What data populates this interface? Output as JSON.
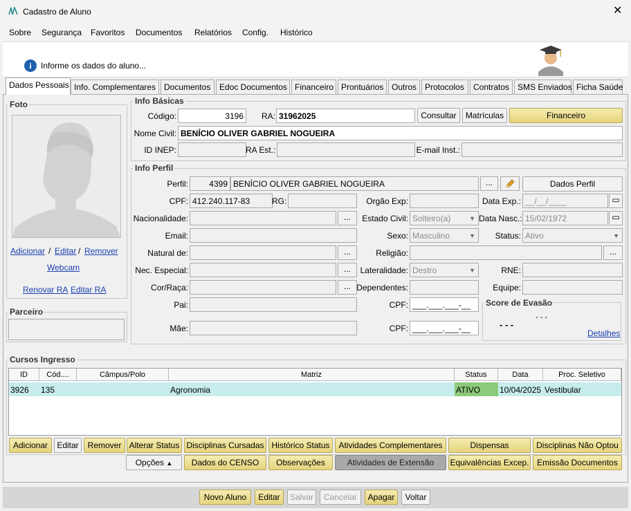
{
  "window": {
    "title": "Cadastro de Aluno"
  },
  "menu": [
    "Sobre",
    "Segurança",
    "Favoritos",
    "Documentos",
    "Relatórios",
    "Config.",
    "Histórico"
  ],
  "banner": {
    "text": "Informe os dados do aluno..."
  },
  "tabs": [
    "Dados Pessoais",
    "Info. Complementares",
    "Documentos",
    "Edoc Documentos",
    "Financeiro",
    "Prontuários",
    "Outros",
    "Protocolos",
    "Contratos",
    "SMS Enviados",
    "Ficha Saúde"
  ],
  "foto": {
    "title": "Foto",
    "adicionar": "Adicionar",
    "sep1": "/",
    "editar": "Editar",
    "sep2": "/",
    "remover": "Remover",
    "webcam": "Webcam",
    "renovar_ra": "Renovar RA",
    "editar_ra": "Editar RA"
  },
  "parceiro": {
    "title": "Parceiro"
  },
  "info_basicas": {
    "title": "Info Básicas",
    "codigo_label": "Código:",
    "codigo": "3196",
    "ra_label": "RA:",
    "ra": "31962025",
    "consultar": "Consultar",
    "matriculas": "Matrículas",
    "financeiro": "Financeiro",
    "nome_label": "Nome Civil:",
    "nome": "BENÍCIO OLIVER GABRIEL NOGUEIRA",
    "inep_label": "ID INEP:",
    "ra_est_label": "RA Est.:",
    "email_inst_label": "E-mail Inst.:"
  },
  "info_perfil": {
    "title": "Info Perfil",
    "perfil_label": "Perfil:",
    "perfil_id": "4399",
    "perfil_nome": "BENÍCIO OLIVER GABRIEL NOGUEIRA",
    "dots": "...",
    "dados_perfil": "Dados Perfil",
    "cpf_label": "CPF:",
    "cpf": "412.240.117-83",
    "rg_label": "RG:",
    "orgao_label": "Orgão Exp:",
    "data_exp_label": "Data Exp.:",
    "data_exp": "__/__/____",
    "nacionalidade_label": "Nacionalidade:",
    "estado_civil_label": "Estado Civil:",
    "estado_civil": "Solteiro(a)",
    "data_nasc_label": "Data Nasc.:",
    "data_nasc": "15/02/1972",
    "email_label": "Email:",
    "sexo_label": "Sexo:",
    "sexo": "Masculino",
    "status_label": "Status:",
    "status": "Ativo",
    "natural_label": "Natural de:",
    "religiao_label": "Religião:",
    "nec_label": "Nec. Especial:",
    "lateralidade_label": "Lateralidade:",
    "lateralidade": "Destro",
    "rne_label": "RNE:",
    "cor_label": "Cor/Raça:",
    "dependentes_label": "Dependentes:",
    "equipe_label": "Equipe:",
    "pai_label": "Pai:",
    "cpf_pai_label": "CPF:",
    "cpf_mask": "___.___.___-__",
    "mae_label": "Mãe:",
    "cpf_mae_label": "CPF:",
    "evasao_title": "Score de Evasão",
    "evasao_val1": "- - -",
    "evasao_val2": "- - -",
    "detalhes": "Detalhes"
  },
  "cursos": {
    "title": "Cursos Ingresso",
    "columns": [
      "ID",
      "Cód....",
      "Câmpus/Polo",
      "Matriz",
      "Status",
      "Data",
      "Proc. Seletivo"
    ],
    "rows": [
      {
        "id": "3926",
        "cod": "135",
        "campus": "",
        "matriz": "Agronomia",
        "status": "ATIVO",
        "data": "10/04/2025",
        "proc": "Vestibular"
      }
    ]
  },
  "actions_row1": [
    "Adicionar",
    "Editar",
    "Remover",
    "Alterar Status",
    "Disciplinas Cursadas",
    "Histórico Status",
    "Atividades Complementares",
    "Dispensas",
    "Disciplinas Não Optou"
  ],
  "actions_row2": {
    "opcoes": "Opções",
    "buttons": [
      "Dados do CENSO",
      "Observações",
      "Atividades de Extensão",
      "Equivalências Excep.",
      "Emissão Documentos"
    ]
  },
  "footer": [
    "Novo Aluno",
    "Editar",
    "Salvar",
    "Cancelar",
    "Apagar",
    "Voltar"
  ],
  "colors": {
    "status_ativo": "#8cc97a",
    "row_bg": "#c6ecec",
    "accent_yellow": "#e8d98a"
  }
}
